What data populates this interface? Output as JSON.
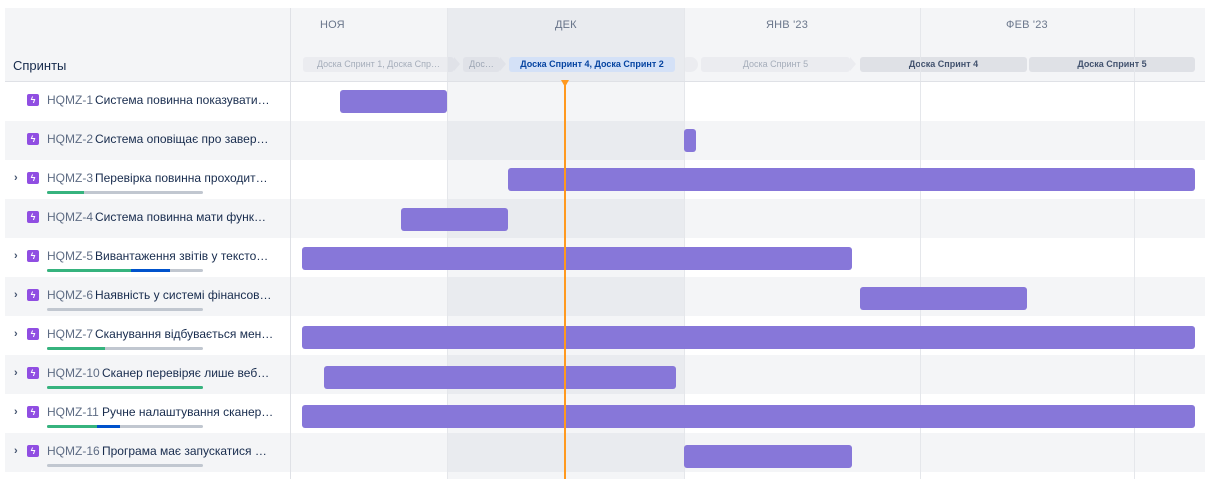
{
  "header": {
    "sprints_label": "Спринты",
    "months": [
      "НОЯ",
      "ДЕК",
      "ЯНВ '23",
      "ФЕВ '23"
    ]
  },
  "sprints": [
    {
      "label": "Доска Спринт 1, Доска Спр…",
      "state": "past"
    },
    {
      "label": "Дос…",
      "state": "past"
    },
    {
      "label": "Доска Спринт 4, Доска Спринт 2",
      "state": "active"
    },
    {
      "label": "",
      "state": "future"
    },
    {
      "label": "Доска Спринт 5",
      "state": "future"
    },
    {
      "label": "Доска Спринт 4",
      "state": "planned"
    },
    {
      "label": "Доска Спринт 5",
      "state": "planned"
    }
  ],
  "rows": [
    {
      "key": "HQMZ-1",
      "title": "Система повинна показувати…",
      "expandable": false
    },
    {
      "key": "HQMZ-2",
      "title": "Система оповіщає про завер…",
      "expandable": false
    },
    {
      "key": "HQMZ-3",
      "title": "Перевірка повинна проходит…",
      "expandable": true,
      "progress": {
        "done": 0.24,
        "in_progress": 0
      }
    },
    {
      "key": "HQMZ-4",
      "title": "Система повинна мати функ…",
      "expandable": false
    },
    {
      "key": "HQMZ-5",
      "title": "Вивантаження звітів у тексто…",
      "expandable": true,
      "progress": {
        "done": 0.54,
        "in_progress": 0.25
      }
    },
    {
      "key": "HQMZ-6",
      "title": "Наявність у системі фінансов…",
      "expandable": true,
      "progress": {
        "done": 0,
        "in_progress": 0
      }
    },
    {
      "key": "HQMZ-7",
      "title": "Сканування відбувається мен…",
      "expandable": true,
      "progress": {
        "done": 0.37,
        "in_progress": 0
      }
    },
    {
      "key": "HQMZ-10",
      "title": "Сканер перевіряє лише веб…",
      "expandable": true,
      "progress": {
        "done": 1.0,
        "in_progress": 0
      }
    },
    {
      "key": "HQMZ-11",
      "title": "Ручне налаштування сканер…",
      "expandable": true,
      "progress": {
        "done": 0.32,
        "in_progress": 0.15
      }
    },
    {
      "key": "HQMZ-16",
      "title": "Програма має запускатися …",
      "expandable": true,
      "progress": {
        "done": 0,
        "in_progress": 0
      }
    }
  ],
  "colors": {
    "bar": "#8777d9",
    "epic_icon": "#904ee2",
    "today": "#ff991f",
    "progress_done": "#36b37e",
    "progress_in_progress": "#0052cc",
    "active_sprint": "#deebff"
  },
  "icons": {
    "expand": "chevron-right-icon",
    "issue_type": "epic-lightning-icon"
  }
}
